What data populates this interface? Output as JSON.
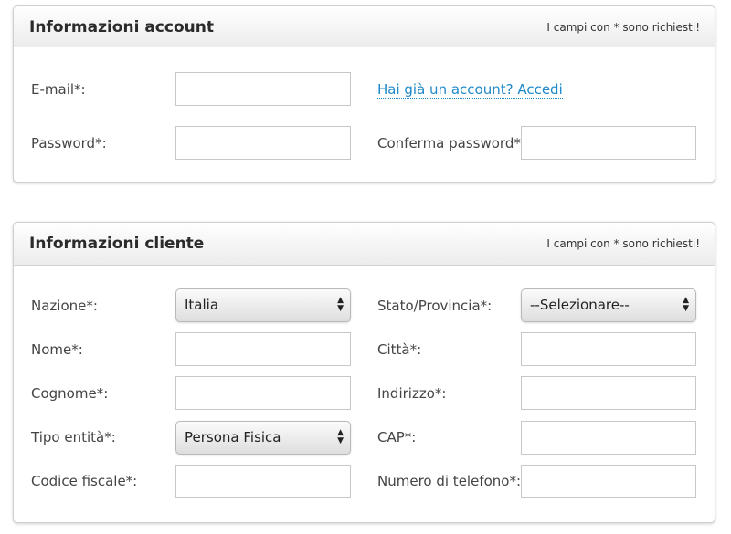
{
  "account": {
    "title": "Informazioni account",
    "required_note": "I campi con * sono richiesti!",
    "email_label": "E-mail*:",
    "login_link": "Hai già un account? Accedi",
    "password_label": "Password*:",
    "confirm_password_label": "Conferma password*:"
  },
  "client": {
    "title": "Informazioni cliente",
    "required_note": "I campi con * sono richiesti!",
    "country_label": "Nazione*:",
    "country_value": "Italia",
    "state_label": "Stato/Provincia*:",
    "state_value": "--Selezionare--",
    "first_name_label": "Nome*:",
    "city_label": "Città*:",
    "last_name_label": "Cognome*:",
    "address_label": "Indirizzo*:",
    "entity_type_label": "Tipo entità*:",
    "entity_type_value": "Persona Fisica",
    "zip_label": "CAP*:",
    "tax_code_label": "Codice fiscale*:",
    "phone_label": "Numero di telefono*:"
  },
  "colors": {
    "link": "#1e88c8",
    "header_gradient_top": "#ffffff",
    "header_gradient_bottom": "#ececec",
    "border": "#cfcfcf"
  },
  "icons": {
    "select_arrows": "updown-arrows-icon"
  }
}
